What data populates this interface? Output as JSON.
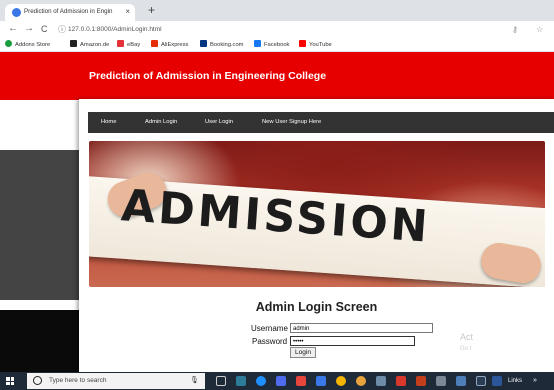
{
  "browser": {
    "tab_title": "Prediction of Admission in Engin",
    "new_tab": "+",
    "tab_close": "×",
    "back": "←",
    "forward": "→",
    "reload": "C",
    "url": "127.0.0.1:8000/AdminLogin.html",
    "bookmarks": [
      {
        "label": "Addons Store",
        "color": "#1a9e3f"
      },
      {
        "label": "Amazon.de",
        "color": "#222222"
      },
      {
        "label": "eBay",
        "color": "#e53238"
      },
      {
        "label": "AliExpress",
        "color": "#e62e04"
      },
      {
        "label": "Booking.com",
        "color": "#003580"
      },
      {
        "label": "Facebook",
        "color": "#1877f2"
      },
      {
        "label": "YouTube",
        "color": "#ff0000"
      }
    ]
  },
  "site": {
    "title": "Prediction of Admission in Engineering College",
    "menu": [
      "Home",
      "Admin Login",
      "User Login",
      "New User Signup Here"
    ],
    "banner_word": "ADMISSION"
  },
  "login": {
    "heading": "Admin Login Screen",
    "username_label": "Username",
    "username_value": "admin",
    "password_label": "Password",
    "password_value": "•••••",
    "button": "Login"
  },
  "watermark": {
    "line1": "Act",
    "line2": "Go t"
  },
  "taskbar": {
    "search_placeholder": "Type here to search",
    "links": "Links"
  }
}
